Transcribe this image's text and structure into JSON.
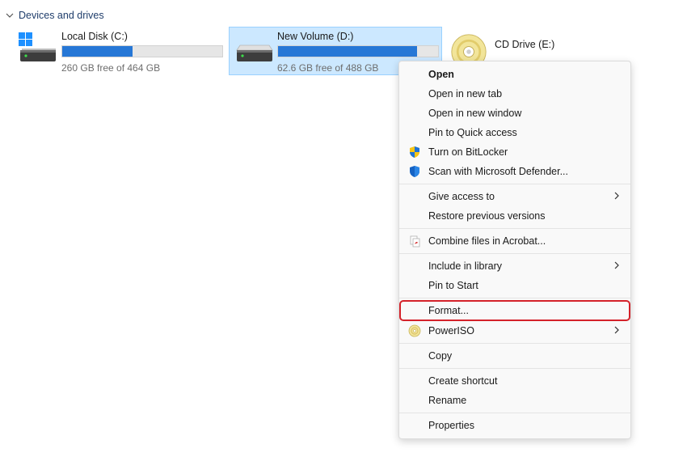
{
  "section": {
    "title": "Devices and drives"
  },
  "drives": [
    {
      "name": "Local Disk (C:)",
      "free_text": "260 GB free of 464 GB",
      "used_fraction": 0.44,
      "icon": "windows-drive-icon"
    },
    {
      "name": "New Volume (D:)",
      "free_text": "62.6 GB free of 488 GB",
      "used_fraction": 0.87,
      "icon": "hard-drive-icon",
      "selected": true
    },
    {
      "name": "CD Drive (E:)",
      "icon": "cd-drive-icon"
    }
  ],
  "context_menu": {
    "items": [
      {
        "label": "Open",
        "bold": true
      },
      {
        "label": "Open in new tab"
      },
      {
        "label": "Open in new window"
      },
      {
        "label": "Pin to Quick access"
      },
      {
        "label": "Turn on BitLocker",
        "icon": "bitlocker-shield-icon"
      },
      {
        "label": "Scan with Microsoft Defender...",
        "icon": "defender-shield-icon"
      },
      {
        "label": "Give access to",
        "submenu": true
      },
      {
        "label": "Restore previous versions"
      },
      {
        "label": "Combine files in Acrobat...",
        "icon": "acrobat-icon"
      },
      {
        "label": "Include in library",
        "submenu": true
      },
      {
        "label": "Pin to Start"
      },
      {
        "label": "Format...",
        "highlighted": true
      },
      {
        "label": "PowerISO",
        "icon": "poweriso-icon",
        "submenu": true
      },
      {
        "label": "Copy"
      },
      {
        "label": "Create shortcut"
      },
      {
        "label": "Rename"
      },
      {
        "label": "Properties"
      }
    ]
  },
  "colors": {
    "accent": "#2677d6",
    "selection": "#cce8ff",
    "highlight_border": "#d4222a"
  }
}
